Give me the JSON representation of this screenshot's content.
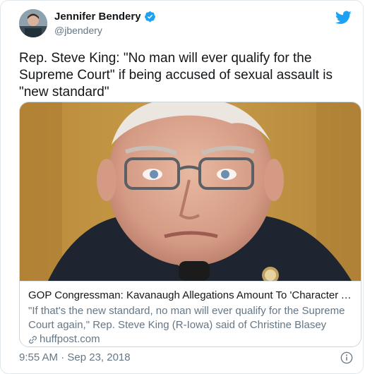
{
  "author": {
    "display_name": "Jennifer Bendery",
    "handle": "@jbendery",
    "verified": true
  },
  "tweet": {
    "text": "Rep. Steve King: \"No man will ever qualify for the Supreme Court\" if being accused of sexual assault is \"new standard\"",
    "emoji": "neutral-face-emoji"
  },
  "card": {
    "title": "GOP Congressman: Kavanaugh Allegations Amount To 'Character Assa...",
    "description": "\"If that's the new standard, no man will ever qualify for the Supreme Court again,\" Rep. Steve King (R-Iowa) said of Christine Blasey Ford's ...",
    "domain": "huffpost.com"
  },
  "timestamp": "9:55 AM · Sep 23, 2018",
  "colors": {
    "twitter_blue": "#1da1f2",
    "text_primary": "#14171a",
    "text_secondary": "#657786",
    "border": "#e1e8ed"
  }
}
